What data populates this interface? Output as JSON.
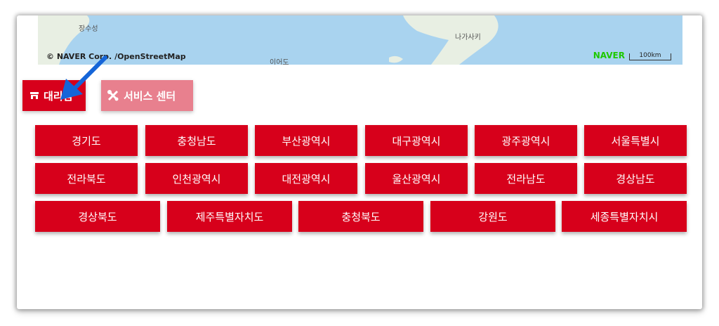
{
  "map": {
    "labels": [
      "장수성",
      "나가사키",
      "이어도"
    ],
    "attribution": "© NAVER Corp. /OpenStreetMap",
    "logo": "NAVER",
    "scale": "100km",
    "colors": {
      "water": "#a9d3ef",
      "land": "#e8efe3"
    }
  },
  "tabs": {
    "dealer": "대리점",
    "service": "서비스 센터"
  },
  "regions": {
    "row1": [
      "경기도",
      "충청남도",
      "부산광역시",
      "대구광역시",
      "광주광역시",
      "서울특별시"
    ],
    "row2": [
      "전라북도",
      "인천광역시",
      "대전광역시",
      "울산광역시",
      "전라남도",
      "경상남도"
    ],
    "row3": [
      "경상북도",
      "제주특별자치도",
      "충청북도",
      "강원도",
      "세종특별자치시"
    ]
  },
  "colors": {
    "primary": "#d7001b",
    "inactive_tab": "#e8808e",
    "annotation_arrow": "#1565d8"
  },
  "icons": {
    "dealer": "store-icon",
    "service": "tools-icon"
  }
}
